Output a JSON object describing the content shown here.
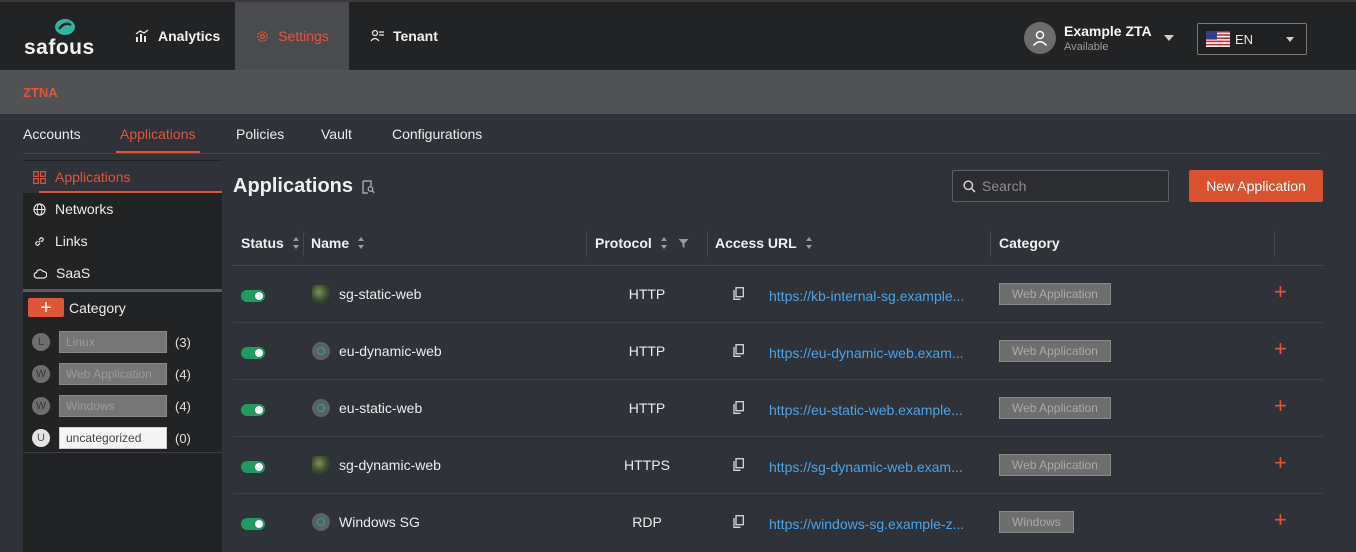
{
  "brand": {
    "logo_text": "safous"
  },
  "topnav": {
    "items": [
      {
        "label": "Analytics",
        "icon": "bar-chart-icon"
      },
      {
        "label": "Settings",
        "icon": "gear-icon"
      },
      {
        "label": "Tenant",
        "icon": "tenant-icon"
      }
    ]
  },
  "user": {
    "name": "Example ZTA",
    "status": "Available"
  },
  "language": {
    "selected": "EN",
    "icon": "us-flag-icon"
  },
  "section": {
    "title": "ZTNA"
  },
  "subtabs": [
    {
      "label": "Accounts"
    },
    {
      "label": "Applications"
    },
    {
      "label": "Policies"
    },
    {
      "label": "Vault"
    },
    {
      "label": "Configurations"
    }
  ],
  "leftnav": {
    "items": [
      {
        "label": "Applications",
        "icon": "grid-icon"
      },
      {
        "label": "Networks",
        "icon": "globe-icon"
      },
      {
        "label": "Links",
        "icon": "link-icon"
      },
      {
        "label": "SaaS",
        "icon": "cloud-icon"
      }
    ],
    "category": {
      "title": "Category",
      "add_label": "+",
      "items": [
        {
          "letter": "L",
          "name": "Linux",
          "count": "(3)"
        },
        {
          "letter": "W",
          "name": "Web Application",
          "count": "(4)"
        },
        {
          "letter": "W",
          "name": "Windows",
          "count": "(4)"
        },
        {
          "letter": "U",
          "name": "uncategorized",
          "count": "(0)"
        }
      ]
    }
  },
  "main": {
    "title": "Applications",
    "search_placeholder": "Search",
    "new_button": "New Application",
    "columns": {
      "status": "Status",
      "name": "Name",
      "protocol": "Protocol",
      "access_url": "Access URL",
      "category": "Category"
    },
    "rows": [
      {
        "enabled": true,
        "icon": "photo",
        "name": "sg-static-web",
        "protocol": "HTTP",
        "url": "https://kb-internal-sg.example...",
        "category": "Web Application"
      },
      {
        "enabled": true,
        "icon": "globe",
        "name": "eu-dynamic-web",
        "protocol": "HTTP",
        "url": "https://eu-dynamic-web.exam...",
        "category": "Web Application"
      },
      {
        "enabled": true,
        "icon": "globe",
        "name": "eu-static-web",
        "protocol": "HTTP",
        "url": "https://eu-static-web.example...",
        "category": "Web Application"
      },
      {
        "enabled": true,
        "icon": "photo",
        "name": "sg-dynamic-web",
        "protocol": "HTTPS",
        "url": "https://sg-dynamic-web.exam...",
        "category": "Web Application"
      },
      {
        "enabled": true,
        "icon": "globe",
        "name": "Windows SG",
        "protocol": "RDP",
        "url": "https://windows-sg.example-z...",
        "category": "Windows"
      }
    ]
  },
  "colors": {
    "accent": "#e0553a",
    "toggle_on": "#1e9b60",
    "link": "#4aa3e8"
  }
}
